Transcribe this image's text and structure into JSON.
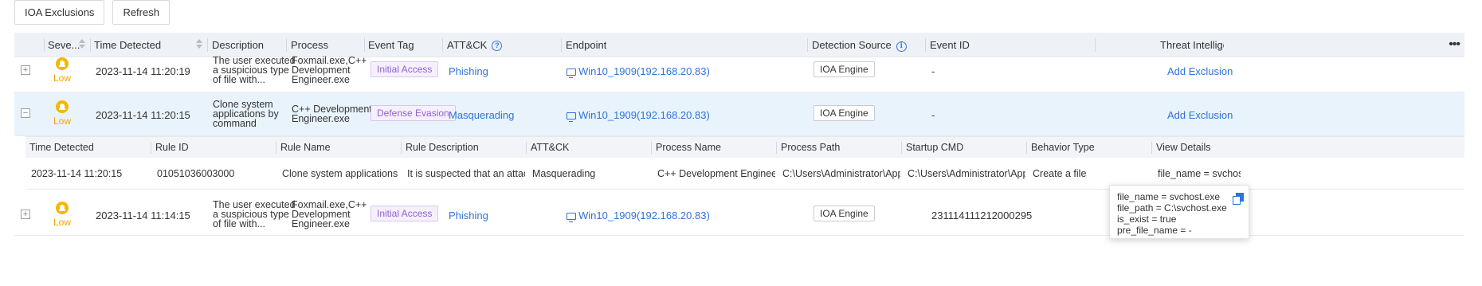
{
  "toolbar": {
    "ioa_exclusions": "IOA Exclusions",
    "refresh": "Refresh"
  },
  "columns": {
    "severity": "Seve...",
    "time_detected": "Time Detected",
    "description": "Description",
    "process": "Process",
    "event_tag": "Event Tag",
    "attck": "ATT&CK",
    "endpoint": "Endpoint",
    "detection_source": "Detection Source",
    "event_id": "Event ID",
    "threat_intel": "Threat Intelligen",
    "more": "•••"
  },
  "rows": [
    {
      "severity": "Low",
      "time": "2023-11-14 11:20:19",
      "description_lines": [
        "The user executed",
        "a suspicious type",
        "of file with..."
      ],
      "process_lines": [
        "Foxmail.exe,C++",
        "Development",
        "Engineer.exe"
      ],
      "event_tag": "Initial Access",
      "attck": "Phishing",
      "endpoint": "Win10_1909(192.168.20.83)",
      "source": "IOA Engine",
      "event_id": "-",
      "action": "Add Exclusion",
      "expander": "+"
    },
    {
      "severity": "Low",
      "time": "2023-11-14 11:20:15",
      "description_lines": [
        "Clone system",
        "applications by",
        "command"
      ],
      "process_lines": [
        "C++ Development",
        "Engineer.exe"
      ],
      "event_tag": "Defense Evasion",
      "attck": "Masquerading",
      "endpoint": "Win10_1909(192.168.20.83)",
      "source": "IOA Engine",
      "event_id": "-",
      "action": "Add Exclusion",
      "expander": "−"
    },
    {
      "severity": "Low",
      "time": "2023-11-14 11:14:15",
      "description_lines": [
        "The user executed",
        "a suspicious type",
        "of file with..."
      ],
      "process_lines": [
        "Foxmail.exe,C++",
        "Development",
        "Engineer.exe"
      ],
      "event_tag": "Initial Access",
      "attck": "Phishing",
      "endpoint": "Win10_1909(192.168.20.83)",
      "source": "IOA Engine",
      "event_id": "231114111212000295",
      "action": "",
      "expander": "+"
    }
  ],
  "detail": {
    "headers": {
      "time_detected": "Time Detected",
      "rule_id": "Rule ID",
      "rule_name": "Rule Name",
      "rule_description": "Rule Description",
      "attck": "ATT&CK",
      "process_name": "Process Name",
      "process_path": "Process Path",
      "startup_cmd": "Startup CMD",
      "behavior_type": "Behavior Type",
      "view_details": "View Details"
    },
    "row": {
      "time_detected": "2023-11-14 11:20:15",
      "rule_id": "01051036003000",
      "rule_name": "Clone system applications by...",
      "rule_description": "It is suspected that an attack...",
      "attck": "Masquerading",
      "process_name": "C++ Development Engineer.exe",
      "process_path": "C:\\Users\\Administrator\\AppD...",
      "startup_cmd": "C:\\Users\\Administrator\\AppD...",
      "behavior_type": "Create a file",
      "view_details": "file_name = svchost.e"
    }
  },
  "popup": {
    "lines": [
      "file_name = svchost.exe",
      "file_path = C:\\svchost.exe",
      "is_exist = true",
      "pre_file_name = -"
    ]
  },
  "colors": {
    "accent": "#2e74d8",
    "low_severity": "#f0a500",
    "tag": "#9061d0",
    "row_highlight": "#e9f3fc",
    "header_bg": "#eef1f6"
  }
}
